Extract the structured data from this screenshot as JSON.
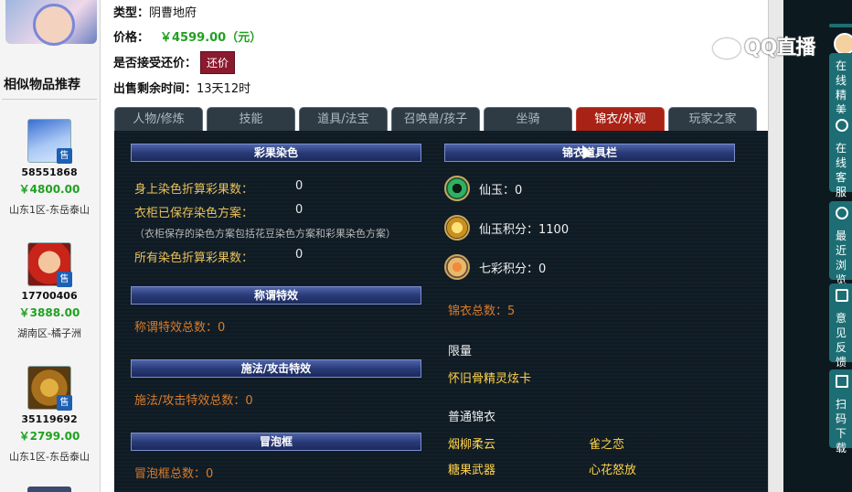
{
  "info": {
    "type_label": "类型：",
    "type_value": "阴曹地府",
    "price_label": "价格：",
    "price_value": "￥4599.00（元）",
    "bargain_label": "是否接受还价：",
    "bargain_button": "还价",
    "remaining_label": "出售剩余时间：",
    "remaining_value": "13天12时"
  },
  "similar": {
    "title": "相似物品推荐",
    "sell_badge": "售",
    "items": [
      {
        "id": "58551868",
        "price": "￥4800.00",
        "server": "山东1区-东岳泰山"
      },
      {
        "id": "17700406",
        "price": "￥3888.00",
        "server": "湖南区-橘子洲"
      },
      {
        "id": "35119692",
        "price": "￥2799.00",
        "server": "山东1区-东岳泰山"
      }
    ]
  },
  "tabs": [
    "人物/修炼",
    "技能",
    "道具/法宝",
    "召唤兽/孩子",
    "坐骑",
    "锦衣/外观",
    "玩家之家"
  ],
  "active_tab": 5,
  "panel": {
    "dye_title": "彩果染色",
    "dye_rows": [
      {
        "label": "身上染色折算彩果数：",
        "value": "0"
      },
      {
        "label": "衣柜已保存染色方案：",
        "value": "0"
      }
    ],
    "dye_note": "（衣柜保存的染色方案包括花豆染色方案和彩果染色方案）",
    "dye_total_label": "所有染色折算彩果数：",
    "dye_total_value": "0",
    "title_effect_title": "称谓特效",
    "title_effect_total": "称谓特效总数：0",
    "cast_effect_title": "施法/攻击特效",
    "cast_effect_total": "施法/攻击特效总数：0",
    "bubble_title": "冒泡框",
    "bubble_total": "冒泡框总数：0",
    "items_title": "锦衣道具栏",
    "currency": [
      {
        "label": "仙玉：0",
        "icon": "jade-icon"
      },
      {
        "label": "仙玉积分：1100",
        "icon": "ticket-icon"
      },
      {
        "label": "七彩积分：0",
        "icon": "rainbow-icon"
      }
    ],
    "outfit_total": "锦衣总数：5",
    "limited_label": "限量",
    "limited_items": [
      "怀旧骨精灵炫卡"
    ],
    "normal_label": "普通锦衣",
    "normal_items": [
      "烟柳柔云",
      "雀之恋",
      "糖果武器",
      "心花怒放"
    ]
  },
  "overlay": {
    "logo": "QQ直播",
    "side_buttons": [
      "在线精美",
      "在线客服",
      "最近浏览",
      "意见反馈",
      "扫码下载"
    ]
  },
  "colors": {
    "price_green": "#21a121",
    "bargain_bg": "#8b1a2e",
    "active_tab": "#a82216",
    "panel_bg": "#0f1b24",
    "gold_text": "#e8c15a"
  }
}
